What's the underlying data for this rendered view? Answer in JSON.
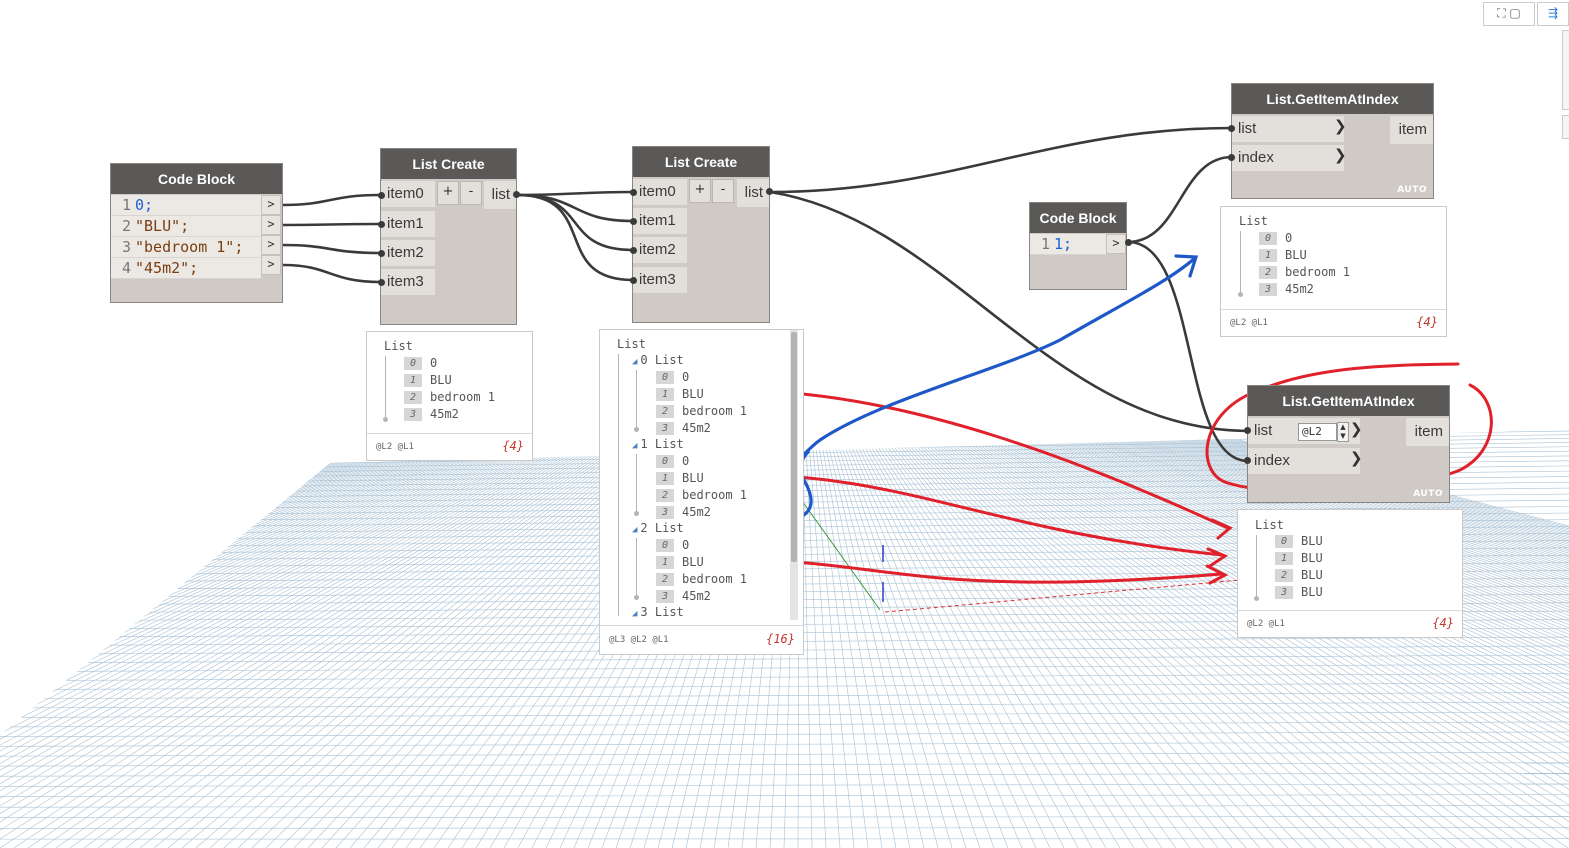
{
  "colors": {
    "node_title": "#5b5957",
    "node_body": "#cfcac5",
    "wire": "#3a3a3a",
    "annotation_red": "#e0202a",
    "annotation_blue": "#1e58c8",
    "grid": "#9fb9cc"
  },
  "toolbar": {
    "icon_left": "camera-icon",
    "icon_right": "layout-icon"
  },
  "code_block_1": {
    "title": "Code Block",
    "lines": [
      {
        "n": "1",
        "text": "0;"
      },
      {
        "n": "2",
        "text": "\"BLU\";"
      },
      {
        "n": "3",
        "text": "\"bedroom 1\";"
      },
      {
        "n": "4",
        "text": "\"45m2\";"
      }
    ],
    "out_symbol": ">"
  },
  "list_create_1": {
    "title": "List Create",
    "inputs": [
      "item0",
      "item1",
      "item2",
      "item3"
    ],
    "plus": "+",
    "minus": "-",
    "output": "list"
  },
  "list_create_2": {
    "title": "List Create",
    "inputs": [
      "item0",
      "item1",
      "item2",
      "item3"
    ],
    "plus": "+",
    "minus": "-",
    "output": "list"
  },
  "code_block_2": {
    "title": "Code Block",
    "lines": [
      {
        "n": "1",
        "text": "1;"
      }
    ],
    "out_symbol": ">"
  },
  "get_item_1": {
    "title": "List.GetItemAtIndex",
    "inputs": [
      "list",
      "index"
    ],
    "output": "item",
    "lacing": "AUTO"
  },
  "get_item_2": {
    "title": "List.GetItemAtIndex",
    "inputs": [
      "list",
      "index"
    ],
    "level": "@L2",
    "output": "item",
    "lacing": "AUTO"
  },
  "watch_1": {
    "header": "List",
    "items": [
      {
        "i": "0",
        "v": "0"
      },
      {
        "i": "1",
        "v": "BLU"
      },
      {
        "i": "2",
        "v": "bedroom 1"
      },
      {
        "i": "3",
        "v": "45m2"
      }
    ],
    "levels": "@L2 @L1",
    "count": "{4}"
  },
  "watch_2": {
    "header": "List",
    "groups": [
      {
        "label": "0 List",
        "items": [
          {
            "i": "0",
            "v": "0"
          },
          {
            "i": "1",
            "v": "BLU"
          },
          {
            "i": "2",
            "v": "bedroom 1"
          },
          {
            "i": "3",
            "v": "45m2"
          }
        ]
      },
      {
        "label": "1 List",
        "items": [
          {
            "i": "0",
            "v": "0"
          },
          {
            "i": "1",
            "v": "BLU"
          },
          {
            "i": "2",
            "v": "bedroom 1"
          },
          {
            "i": "3",
            "v": "45m2"
          }
        ]
      },
      {
        "label": "2 List",
        "items": [
          {
            "i": "0",
            "v": "0"
          },
          {
            "i": "1",
            "v": "BLU"
          },
          {
            "i": "2",
            "v": "bedroom 1"
          },
          {
            "i": "3",
            "v": "45m2"
          }
        ]
      },
      {
        "label": "3 List",
        "items": []
      }
    ],
    "levels": "@L3 @L2 @L1",
    "count": "{16}"
  },
  "watch_3": {
    "header": "List",
    "items": [
      {
        "i": "0",
        "v": "0"
      },
      {
        "i": "1",
        "v": "BLU"
      },
      {
        "i": "2",
        "v": "bedroom 1"
      },
      {
        "i": "3",
        "v": "45m2"
      }
    ],
    "levels": "@L2 @L1",
    "count": "{4}"
  },
  "watch_4": {
    "header": "List",
    "items": [
      {
        "i": "0",
        "v": "BLU"
      },
      {
        "i": "1",
        "v": "BLU"
      },
      {
        "i": "2",
        "v": "BLU"
      },
      {
        "i": "3",
        "v": "BLU"
      }
    ],
    "levels": "@L2 @L1",
    "count": "{4}"
  }
}
